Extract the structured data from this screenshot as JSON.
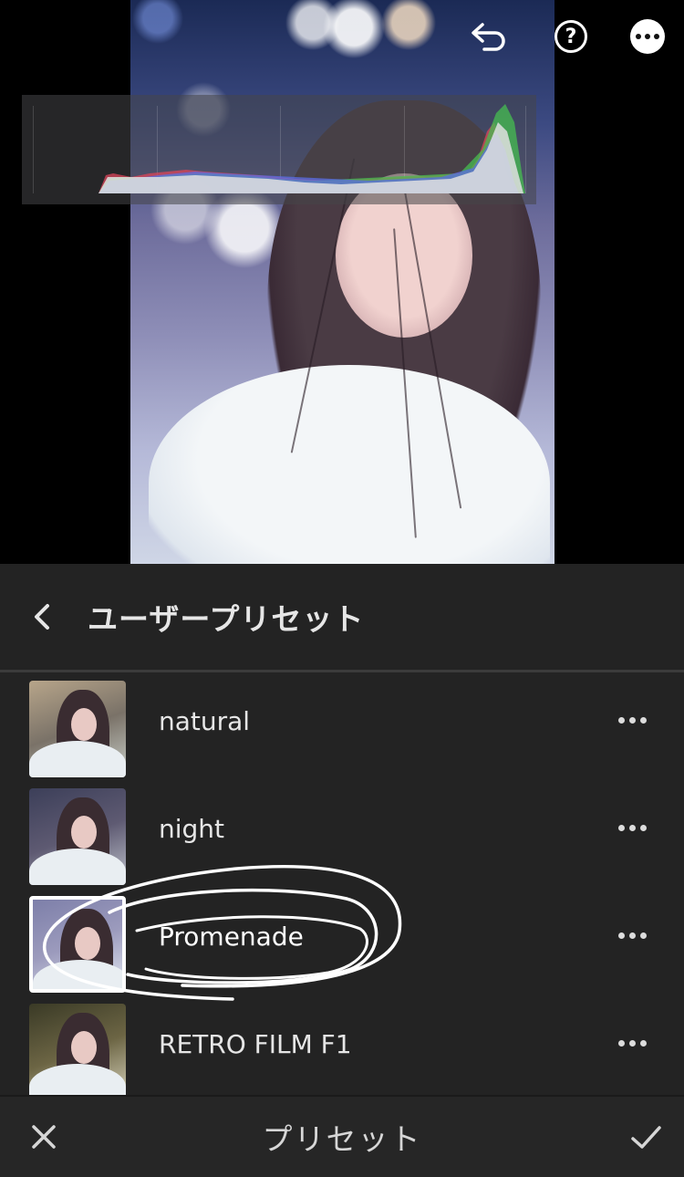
{
  "header": {
    "title": "ユーザープリセット"
  },
  "top_icons": [
    "undo-icon",
    "help-icon",
    "more-icon"
  ],
  "presets": [
    {
      "label": "natural",
      "selected": false
    },
    {
      "label": "night",
      "selected": false
    },
    {
      "label": "Promenade",
      "selected": true
    },
    {
      "label": "RETRO FILM F1",
      "selected": false
    }
  ],
  "footer": {
    "title": "プリセット"
  },
  "histogram": {
    "channels": [
      "red",
      "green",
      "blue",
      "luminance"
    ]
  },
  "colors": {
    "panel_bg": "#232323",
    "footer_bg": "#262626",
    "text": "#e6e6e6",
    "annotation": "#ffffff"
  }
}
